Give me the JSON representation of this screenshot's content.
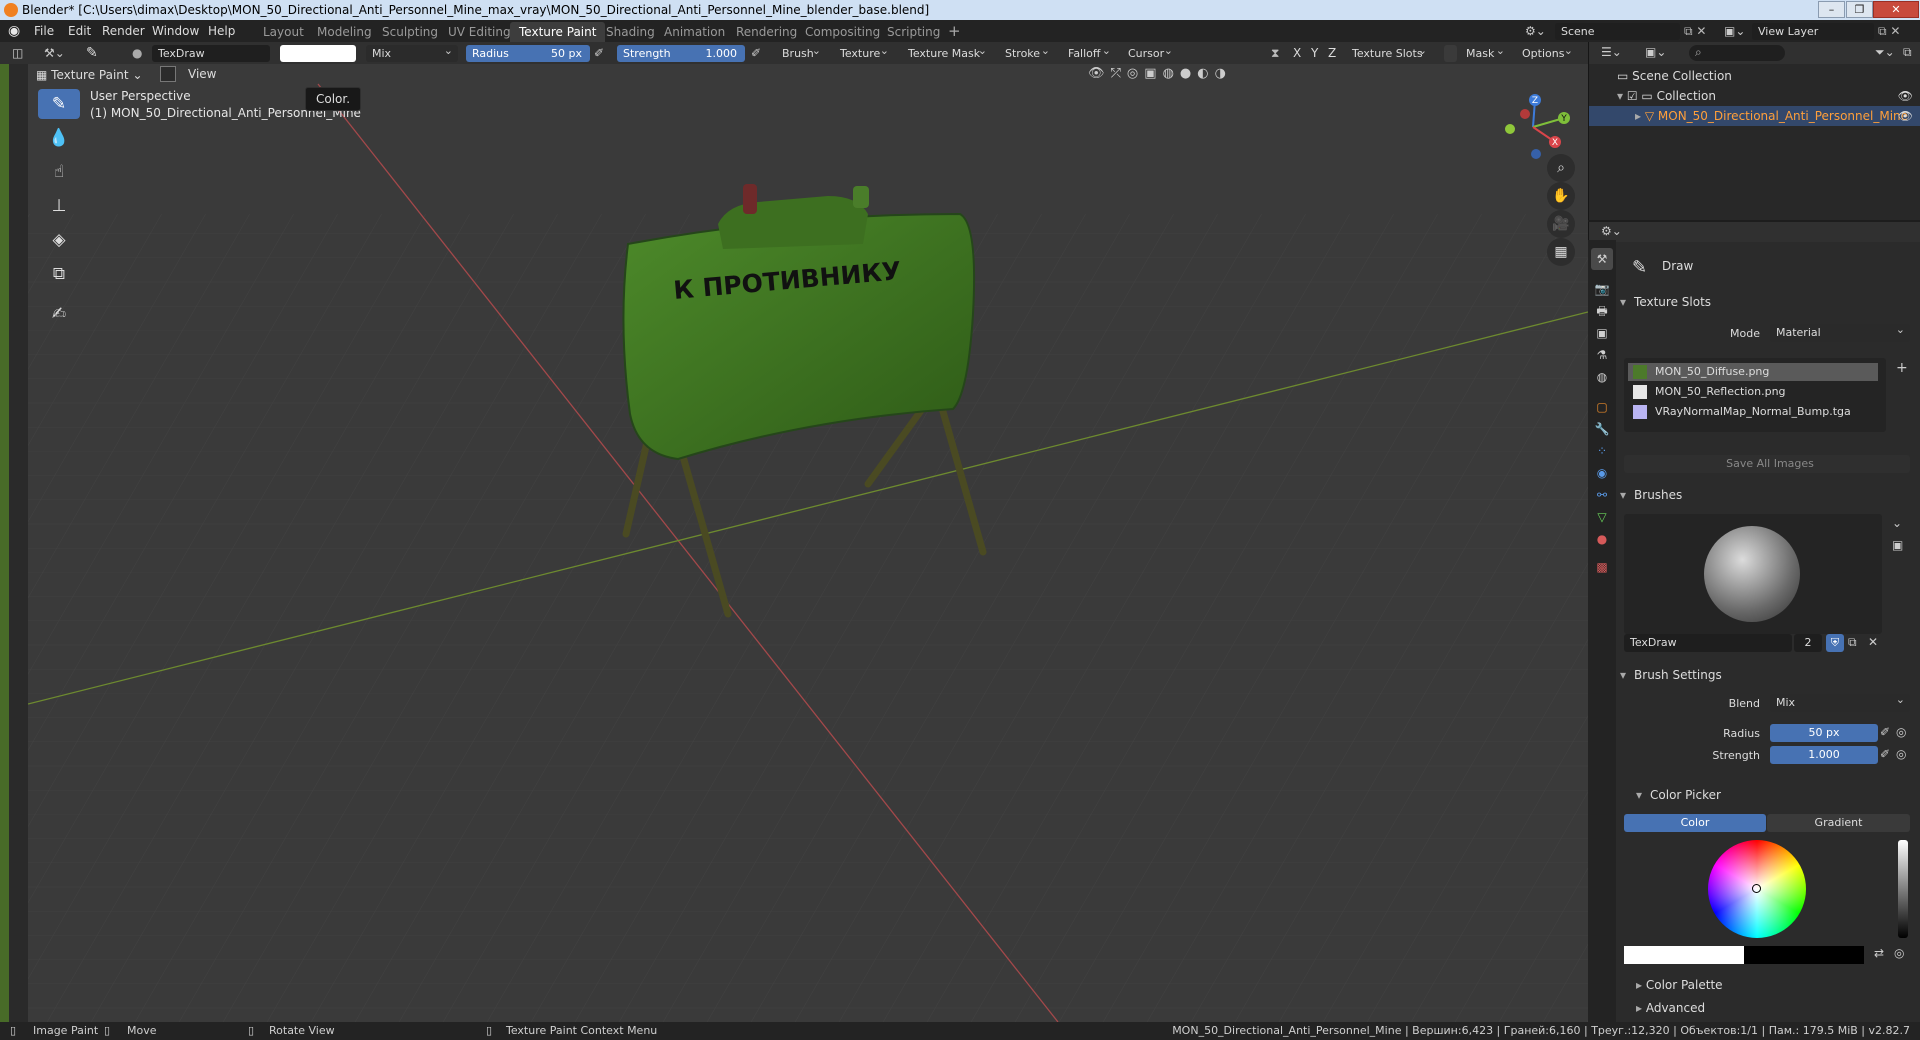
{
  "window": {
    "title": "Blender* [C:\\Users\\dimax\\Desktop\\MON_50_Directional_Anti_Personnel_Mine_max_vray\\MON_50_Directional_Anti_Personnel_Mine_blender_base.blend]"
  },
  "menu": {
    "file": "File",
    "edit": "Edit",
    "render": "Render",
    "window": "Window",
    "help": "Help"
  },
  "workspaces": [
    "Layout",
    "Modeling",
    "Sculpting",
    "UV Editing",
    "Texture Paint",
    "Shading",
    "Animation",
    "Rendering",
    "Compositing",
    "Scripting"
  ],
  "active_workspace": "Texture Paint",
  "scene": {
    "name": "Scene",
    "view_layer": "View Layer"
  },
  "tool_header": {
    "brush_name": "TexDraw",
    "blend": "Mix",
    "radius_label": "Radius",
    "radius_value": "50 px",
    "strength_label": "Strength",
    "strength_value": "1.000",
    "menus": [
      "Brush",
      "Texture",
      "Texture Mask",
      "Stroke",
      "Falloff",
      "Cursor"
    ],
    "axes": [
      "X",
      "Y",
      "Z"
    ],
    "texture_slots": "Texture Slots",
    "mask": "Mask",
    "options": "Options"
  },
  "viewport_header": {
    "mode": "Texture Paint",
    "view": "View"
  },
  "viewport": {
    "perspective": "User Perspective",
    "object_label": "(1) MON_50_Directional_Anti_Personnel_Mine",
    "tooltip": "Color.",
    "mine_text": "К ПРОТИВНИКУ",
    "gizmo": {
      "x": "X",
      "y": "Y",
      "z": "Z"
    }
  },
  "outliner": {
    "scene_collection": "Scene Collection",
    "collection": "Collection",
    "object": "MON_50_Directional_Anti_Personnel_Mine"
  },
  "properties": {
    "tool_name": "Draw",
    "texture_slots_header": "Texture Slots",
    "mode_label": "Mode",
    "mode_value": "Material",
    "slots": [
      "MON_50_Diffuse.png",
      "MON_50_Reflection.png",
      "VRayNormalMap_Normal_Bump.tga"
    ],
    "save_all": "Save All Images",
    "brushes_header": "Brushes",
    "brush_name": "TexDraw",
    "brush_users": "2",
    "brush_settings_header": "Brush Settings",
    "blend_label": "Blend",
    "blend_value": "Mix",
    "radius_label": "Radius",
    "radius_value": "50 px",
    "strength_label": "Strength",
    "strength_value": "1.000",
    "color_picker_header": "Color Picker",
    "color_tab": "Color",
    "gradient_tab": "Gradient",
    "color_palette": "Color Palette",
    "advanced": "Advanced"
  },
  "statusbar": {
    "image_paint": "Image Paint",
    "move": "Move",
    "rotate_view": "Rotate View",
    "context_menu": "Texture Paint Context Menu",
    "stats": "MON_50_Directional_Anti_Personnel_Mine | Вершин:6,423 | Граней:6,160 | Треуг.:12,320 | Объектов:1/1 | Пам.: 179.5 MiB | v2.82.7"
  },
  "colors": {
    "accent_blue": "#4772b3",
    "selected_object": "#ff9f3a",
    "mine_green": "#3f6e1f",
    "x_axis": "#d9454a",
    "y_axis": "#7fbf3a",
    "z_axis": "#3d7bd9"
  }
}
